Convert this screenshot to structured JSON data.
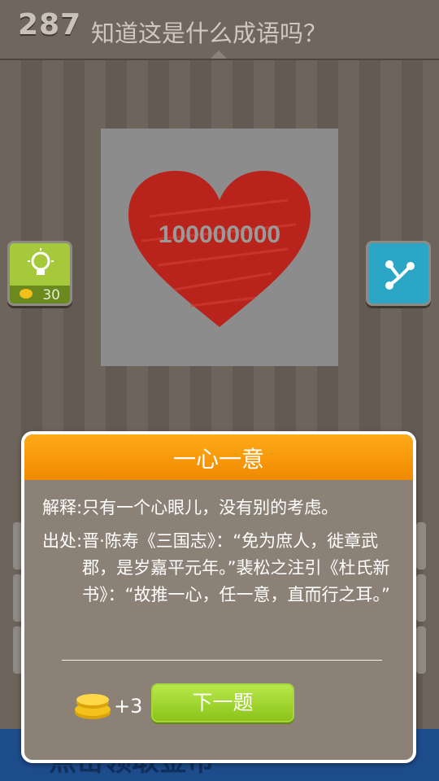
{
  "header": {
    "level": "287",
    "question": "知道这是什么成语吗？"
  },
  "puzzle": {
    "number_text": "100000000"
  },
  "hint": {
    "cost": "30"
  },
  "banner": {
    "text": "点击领取金币"
  },
  "popup": {
    "title": "一心一意",
    "explain_label": "解释:",
    "explain_text": "只有一个心眼儿，没有别的考虑。",
    "source_label": "出处:",
    "source_text": "晋·陈寿《三国志》：“免为庶人，徙章武郡，是岁嘉平元年。”裴松之注引《杜氏新书》：“故推一心，任一意，直而行之耳。”",
    "reward": "+3",
    "next_label": "下一题"
  },
  "colors": {
    "accent_orange": "#f59a0c",
    "button_green": "#9bd52a",
    "hint_green": "#a6c83b",
    "share_blue": "#2ba7c5"
  }
}
